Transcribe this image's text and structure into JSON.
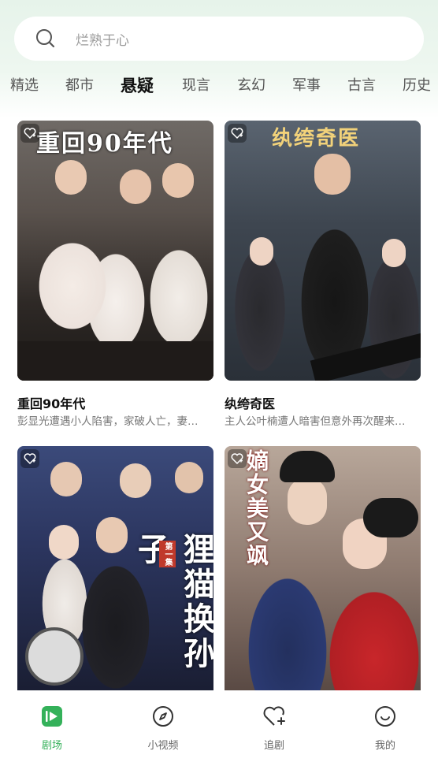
{
  "search": {
    "placeholder": "烂熟于心"
  },
  "tabs": [
    {
      "label": "精选"
    },
    {
      "label": "都市"
    },
    {
      "label": "悬疑"
    },
    {
      "label": "现言"
    },
    {
      "label": "玄幻"
    },
    {
      "label": "军事"
    },
    {
      "label": "古言"
    },
    {
      "label": "历史"
    }
  ],
  "active_tab": "悬疑",
  "cards": [
    {
      "title": "重回90年代",
      "desc": "彭显光遭遇小人陷害，家破人亡，妻…",
      "poster_text": "重回90年代"
    },
    {
      "title": "纨绔奇医",
      "desc": "主人公叶楠遭人暗害但意外再次醒来…",
      "poster_text": "纨绔奇医"
    },
    {
      "title": "",
      "desc": "",
      "poster_text": "狸猫换孙子",
      "poster_sub": "第一集"
    },
    {
      "title": "",
      "desc": "",
      "poster_text": "嫡女美又飒"
    }
  ],
  "nav": [
    {
      "label": "剧场",
      "icon": "theater-icon",
      "active": true
    },
    {
      "label": "小视频",
      "icon": "compass-icon",
      "active": false
    },
    {
      "label": "追剧",
      "icon": "heart-plus-icon",
      "active": false
    },
    {
      "label": "我的",
      "icon": "smile-icon",
      "active": false
    }
  ],
  "colors": {
    "accent": "#34b15a",
    "header_bg": "#e6f3ea"
  }
}
